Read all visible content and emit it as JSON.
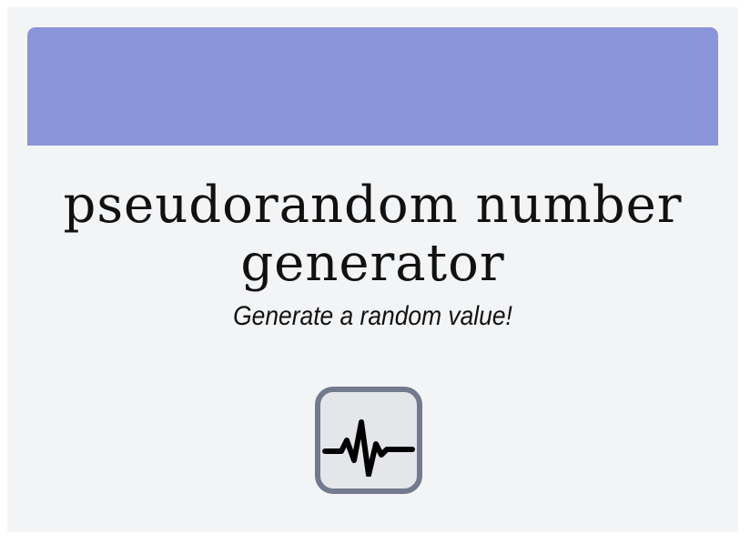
{
  "header": {
    "title": "pseudorandom number generator",
    "subtitle": "Generate a random value!"
  },
  "generate_button": {
    "icon": "waveform-icon"
  },
  "colors": {
    "banner": "#8a94d8",
    "background": "#f3f4f6",
    "button_border": "#737a8d",
    "button_fill": "#e5e6ea"
  }
}
